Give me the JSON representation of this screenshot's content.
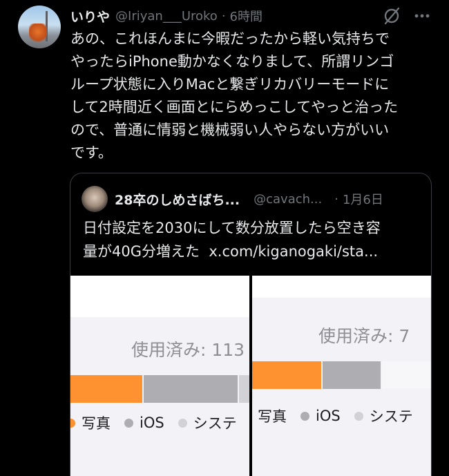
{
  "tweet": {
    "display_name": "いりや",
    "handle": "@Iriyan___Uroko",
    "separator": "·",
    "time": "6時間",
    "text": "あの、これほんまに今暇だったから軽い気持ちで\nやったらiPhone動かなくなりまして、所謂リンゴ\nループ状態に入りMacと繋ぎリカバリーモードに\nして2時間近く画面とにらめっこしてやっと治った\nので、普通に情弱と機械弱い人やらない方がいい\nです。",
    "icons": [
      "grok-icon",
      "more-icon"
    ]
  },
  "quote": {
    "display_name": "28卒のしめさばち...",
    "handle": "@cavach...",
    "separator": "·",
    "time": "1月6日",
    "text": "日付設定を2030にして数分放置したら空き容\n量が40G分増えた  x.com/kiganogaki/sta..."
  },
  "screenshots": {
    "left": {
      "usage_text": "使用済み: 113",
      "legend": [
        {
          "label": "写真",
          "color": "#ff9230"
        },
        {
          "label": "iOS",
          "color": "#aeaeb2"
        },
        {
          "label": "システ",
          "color": "#d1d1d6"
        }
      ]
    },
    "right": {
      "usage_text": "使用済み: 7",
      "legend": [
        {
          "label": "写真",
          "color": "#ff9230"
        },
        {
          "label": "iOS",
          "color": "#aeaeb2"
        },
        {
          "label": "システ",
          "color": "#d1d1d6"
        }
      ]
    }
  },
  "colors": {
    "background": "#000000",
    "text_primary": "#e7e9ea",
    "text_secondary": "#71767b",
    "orange": "#ff9230",
    "gray": "#aeaeb2"
  }
}
